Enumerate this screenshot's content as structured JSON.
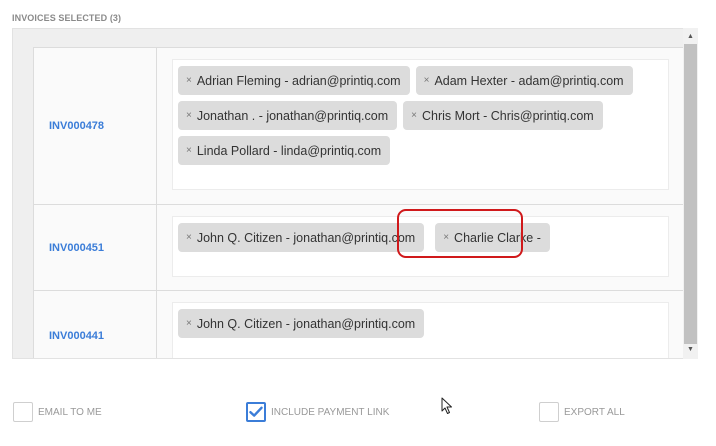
{
  "header": {
    "title": "INVOICES SELECTED (3)"
  },
  "invoices": [
    {
      "id": "INV000478",
      "recipients": [
        "Adrian Fleming - adrian@printiq.com",
        "Adam Hexter - adam@printiq.com",
        "Jonathan . - jonathan@printiq.com",
        "Chris Mort - Chris@printiq.com",
        "Linda Pollard - linda@printiq.com"
      ]
    },
    {
      "id": "INV000451",
      "recipients": [
        "John Q. Citizen - jonathan@printiq.com",
        "Charlie Clarke -"
      ]
    },
    {
      "id": "INV000441",
      "recipients": [
        "John Q. Citizen - jonathan@printiq.com"
      ]
    }
  ],
  "tag_remove_glyph": "×",
  "options": {
    "email_to_me": {
      "label": "EMAIL TO ME",
      "checked": false
    },
    "include_payment_link": {
      "label": "INCLUDE PAYMENT LINK",
      "checked": true
    },
    "export_all": {
      "label": "EXPORT ALL",
      "checked": false
    }
  },
  "colors": {
    "link": "#3b7dd8",
    "tag_bg": "#dcdcdc",
    "highlight": "#d0191b"
  },
  "icons": {
    "remove": "close-icon",
    "scroll_up": "arrow-up-icon",
    "scroll_down": "arrow-down-icon",
    "check": "checkmark-icon",
    "cursor": "mouse-cursor-icon"
  }
}
